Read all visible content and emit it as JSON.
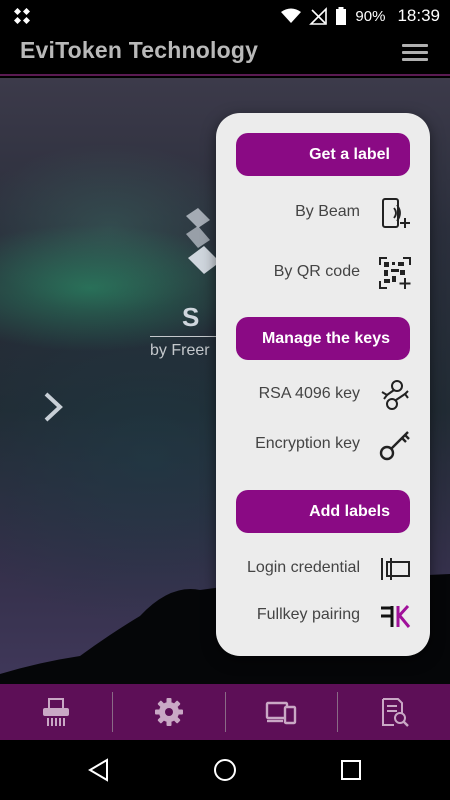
{
  "status_bar": {
    "battery": "90%",
    "time": "18:39",
    "icons": [
      "app-icon",
      "wifi-icon",
      "no-signal-icon",
      "battery-icon"
    ]
  },
  "app_bar": {
    "title": "EviToken Technology",
    "menu_icon": "hamburger-icon"
  },
  "background": {
    "brand_partial": "S",
    "subtitle_partial": "by Freer",
    "next_icon": "chevron-right-icon"
  },
  "popup": {
    "sections": [
      {
        "header": "Get a label",
        "items": [
          {
            "label": "By Beam",
            "icon": "phone-beam-add-icon"
          },
          {
            "label": "By QR code",
            "icon": "qr-add-icon"
          }
        ]
      },
      {
        "header": "Manage the keys",
        "items": [
          {
            "label": "RSA 4096 key",
            "icon": "rsa-key-icon"
          },
          {
            "label": "Encryption key",
            "icon": "key-icon"
          }
        ]
      },
      {
        "header": "Add labels",
        "items": [
          {
            "label": "Login credential",
            "icon": "login-credential-icon"
          },
          {
            "label": "Fullkey pairing",
            "icon": "fullkey-icon"
          }
        ]
      }
    ]
  },
  "toolbar": {
    "items": [
      "shredder-icon",
      "settings-icon",
      "devices-icon",
      "document-search-icon"
    ]
  },
  "nav_bar": {
    "items": [
      "back-icon",
      "home-icon",
      "recents-icon"
    ]
  },
  "colors": {
    "accent": "#8a0a84",
    "toolbar": "#5d0f57",
    "popup_bg": "#ececec"
  }
}
